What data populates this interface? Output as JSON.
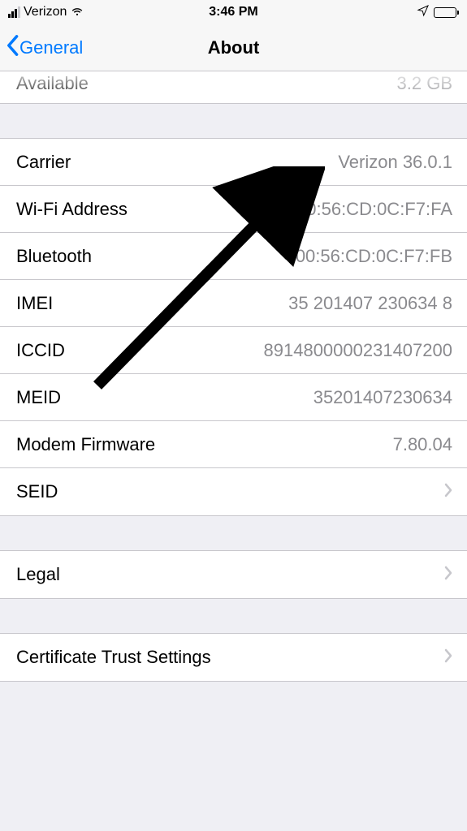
{
  "statusbar": {
    "carrier": "Verizon",
    "time": "3:46 PM"
  },
  "nav": {
    "back_label": "General",
    "title": "About"
  },
  "partial_row": {
    "label": "Available",
    "value": "3.2 GB"
  },
  "info_group": [
    {
      "label": "Carrier",
      "value": "Verizon 36.0.1",
      "disclosure": false
    },
    {
      "label": "Wi-Fi Address",
      "value": "00:56:CD:0C:F7:FA",
      "disclosure": false
    },
    {
      "label": "Bluetooth",
      "value": "00:56:CD:0C:F7:FB",
      "disclosure": false
    },
    {
      "label": "IMEI",
      "value": "35 201407 230634 8",
      "disclosure": false
    },
    {
      "label": "ICCID",
      "value": "8914800000231407200",
      "disclosure": false
    },
    {
      "label": "MEID",
      "value": "35201407230634",
      "disclosure": false
    },
    {
      "label": "Modem Firmware",
      "value": "7.80.04",
      "disclosure": false
    },
    {
      "label": "SEID",
      "value": "",
      "disclosure": true
    }
  ],
  "legal_group": [
    {
      "label": "Legal",
      "disclosure": true
    }
  ],
  "cert_group": [
    {
      "label": "Certificate Trust Settings",
      "disclosure": true
    }
  ]
}
